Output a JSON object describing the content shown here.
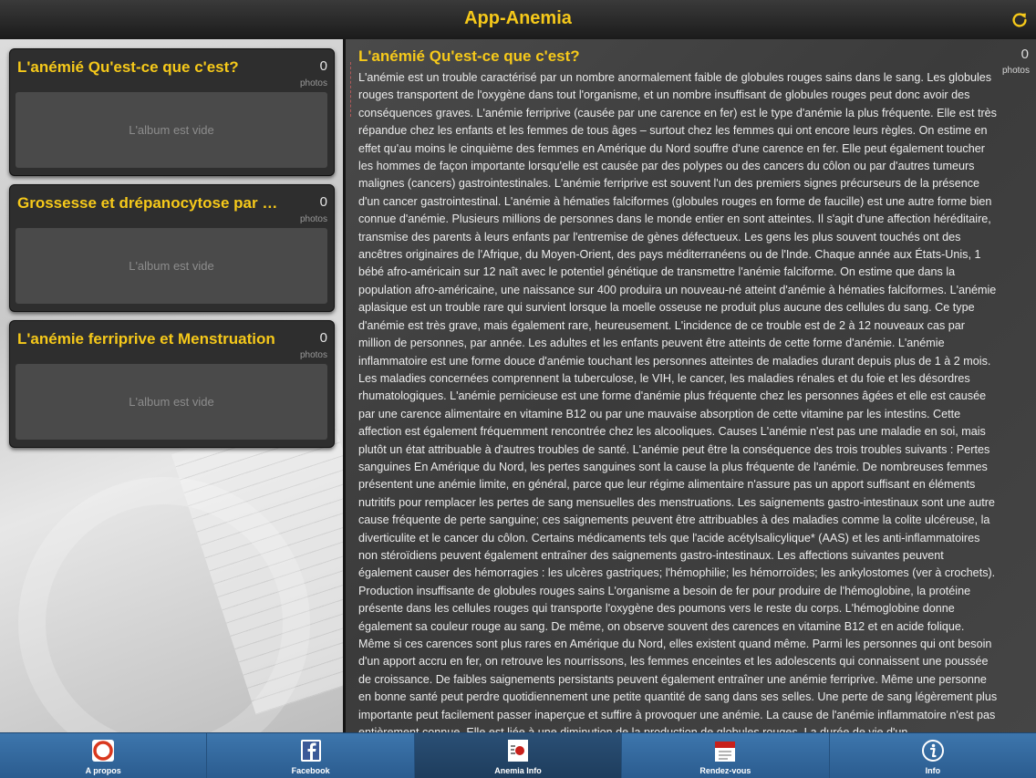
{
  "header": {
    "title": "App-Anemia",
    "refresh_icon": "refresh-icon"
  },
  "albums": [
    {
      "title": "L'anémié Qu'est-ce que c'est?",
      "count": "0",
      "count_label": "photos",
      "empty_text": "L'album est vide"
    },
    {
      "title": "Grossesse et drépanocytose par do...",
      "count": "0",
      "count_label": "photos",
      "empty_text": "L'album est vide"
    },
    {
      "title": "L'anémie ferriprive et Menstruation",
      "count": "0",
      "count_label": "photos",
      "empty_text": "L'album est vide"
    }
  ],
  "article": {
    "title": "L'anémié Qu'est-ce que c'est?",
    "count": "0",
    "count_label": "photos",
    "body": "L'anémie est un trouble caractérisé par un nombre anormalement faible de globules rouges sains dans le sang. Les globules rouges transportent de l'oxygène dans tout l'organisme, et un nombre insuffisant de globules rouges peut donc avoir des conséquences graves. L'anémie ferriprive (causée par une carence en fer) est le type d'anémie la plus fréquente. Elle est très répandue chez les enfants et les femmes de tous âges – surtout chez les femmes qui ont encore leurs règles. On estime en effet qu'au moins le cinquième des femmes en Amérique du Nord souffre d'une carence en fer. Elle peut également toucher les hommes de façon importante lorsqu'elle est causée par des polypes ou des cancers du côlon ou par d'autres tumeurs malignes (cancers) gastrointestinales. L'anémie ferriprive est souvent l'un des premiers signes précurseurs de la présence d'un cancer gastrointestinal. L'anémie à hématies falciformes (globules rouges en forme de faucille) est une autre forme bien connue d'anémie. Plusieurs millions de personnes dans le monde entier en sont atteintes. Il s'agit d'une affection héréditaire, transmise des parents à leurs enfants par l'entremise de gènes défectueux. Les gens les plus souvent touchés ont des ancêtres originaires de l'Afrique, du Moyen-Orient, des pays méditerranéens ou de l'Inde. Chaque année aux États-Unis, 1 bébé afro-américain sur 12 naît avec le potentiel génétique de transmettre l'anémie falciforme. On estime que dans la population afro-américaine, une naissance sur 400 produira un nouveau-né atteint d'anémie à hématies falciformes. L'anémie aplasique est un trouble rare qui survient lorsque la moelle osseuse ne produit plus aucune des cellules du sang. Ce type d'anémie est très grave, mais également rare, heureusement. L'incidence de ce trouble est de 2 à 12 nouveaux cas par million de personnes, par année. Les adultes et les enfants peuvent être atteints de cette forme d'anémie. L'anémie inflammatoire est une forme douce d'anémie touchant les personnes atteintes de maladies durant depuis plus de 1 à 2 mois. Les maladies concernées comprennent la tuberculose, le VIH, le cancer, les maladies rénales et du foie et les désordres rhumatologiques. L'anémie pernicieuse est une forme d'anémie plus fréquente chez les personnes âgées et elle est causée par une carence alimentaire en vitamine B12 ou par une mauvaise absorption de cette vitamine par les intestins. Cette affection est également fréquemment rencontrée chez les alcooliques. Causes L'anémie n'est pas une maladie en soi, mais plutôt un état attribuable à d'autres troubles de santé. L'anémie peut être la conséquence des trois troubles suivants : Pertes sanguines En Amérique du Nord, les pertes sanguines sont la cause la plus fréquente de l'anémie. De nombreuses femmes présentent une anémie limite, en général, parce que leur régime alimentaire n'assure pas un apport suffisant en éléments nutritifs pour remplacer les pertes de sang mensuelles des menstruations. Les saignements gastro-intestinaux sont une autre cause fréquente de perte sanguine; ces saignements peuvent être attribuables à des maladies comme la colite ulcéreuse, la diverticulite et le cancer du côlon. Certains médicaments tels que l'acide acétylsalicylique* (AAS) et les anti-inflammatoires non stéroïdiens peuvent également entraîner des saignements gastro-intestinaux. Les affections suivantes peuvent également causer des hémorragies : les ulcères gastriques; l'hémophilie; les hémorroïdes; les ankylostomes (ver à crochets). Production insuffisante de globules rouges sains L'organisme a besoin de fer pour produire de l'hémoglobine, la protéine présente dans les cellules rouges qui transporte l'oxygène des poumons vers le reste du corps. L'hémoglobine donne également sa couleur rouge au sang. De même, on observe souvent des carences en vitamine B12 et en acide folique. Même si ces carences sont plus rares en Amérique du Nord, elles existent quand même. Parmi les personnes qui ont besoin d'un apport accru en fer, on retrouve les nourrissons, les femmes enceintes et les adolescents qui connaissent une poussée de croissance. De faibles saignements persistants peuvent également entraîner une anémie ferriprive. Même une personne en bonne santé peut perdre quotidiennement une petite quantité de sang dans ses selles. Une perte de sang légèrement plus importante peut facilement passer inaperçue et suffire à provoquer une anémie. La cause de l'anémie inflammatoire n'est pas entièrement connue. Elle est liée à une diminution de la production de globules rouges. La durée de vie d'un"
  },
  "tabs": [
    {
      "label": "A propos",
      "icon": "about-icon",
      "active": false
    },
    {
      "label": "Facebook",
      "icon": "facebook-icon",
      "active": false
    },
    {
      "label": "Anemia Info",
      "icon": "anemia-info-icon",
      "active": true
    },
    {
      "label": "Rendez-vous",
      "icon": "calendar-icon",
      "active": false
    },
    {
      "label": "Info",
      "icon": "info-icon",
      "active": false
    }
  ],
  "colors": {
    "accent": "#f6c91a",
    "tabbar": "#3d76ad"
  }
}
